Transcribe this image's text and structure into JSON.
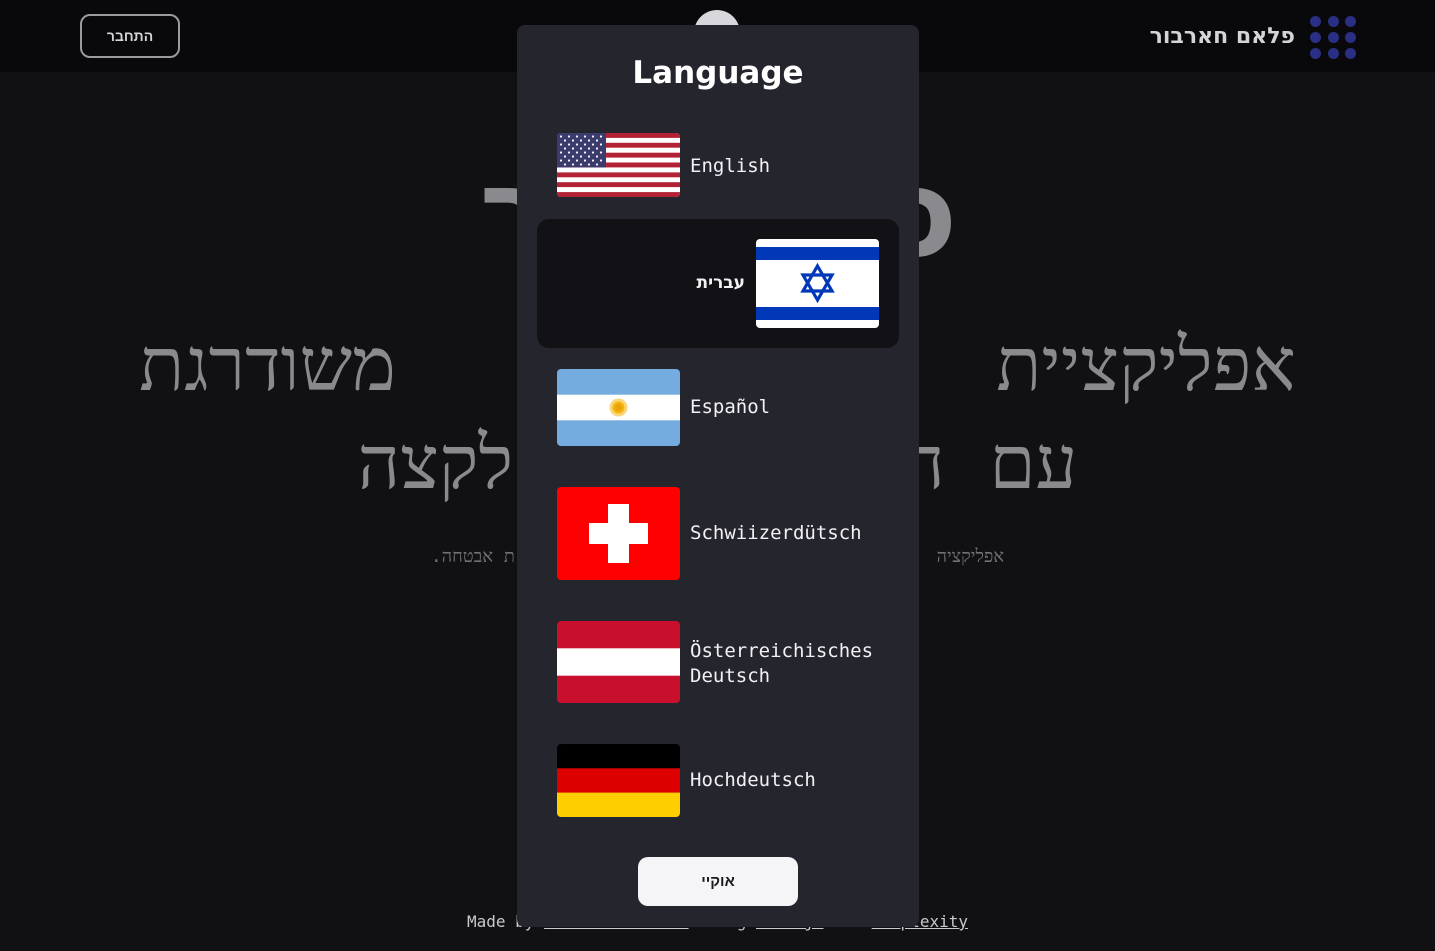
{
  "header": {
    "login_label": "התחבר",
    "brand_name": "פלאם חארבור"
  },
  "hero": {
    "title_visible": "פלא             בור",
    "subtitle_line1_left": "משודרגת",
    "subtitle_line1_accent": "ם",
    "subtitle_line1_right": "אפליקציית",
    "subtitle_line2_left": "לקצה",
    "subtitle_line2_mid": "עם  ה",
    "description_left": "ת אבטחה.",
    "description_right": "אפליקציה"
  },
  "modal": {
    "title": "Language",
    "ok_label": "אוקיי",
    "languages": [
      {
        "label": "English",
        "flag": "us-flag-icon",
        "selected": false
      },
      {
        "label": "עברית",
        "flag": "israel-flag-icon",
        "selected": true
      },
      {
        "label": "Español",
        "flag": "argentina-flag-icon",
        "selected": false
      },
      {
        "label": "Schwiizerdütsch",
        "flag": "switzerland-flag-icon",
        "selected": false
      },
      {
        "label": "Österreichisches Deutsch",
        "flag": "austria-flag-icon",
        "selected": false
      },
      {
        "label": "Hochdeutsch",
        "flag": "germany-flag-icon",
        "selected": false
      }
    ]
  },
  "footer": {
    "made_by": "Made by",
    "author": "Maxim Bortnikov",
    "doing": "doing",
    "tool1": "Next.js",
    "and": "and",
    "tool2": "Perplexity"
  },
  "colors": {
    "modal_bg": "#25252d",
    "selected_bg": "#111116",
    "accent_purple": "#5b3573",
    "logo_dots": "#2a2f86"
  }
}
